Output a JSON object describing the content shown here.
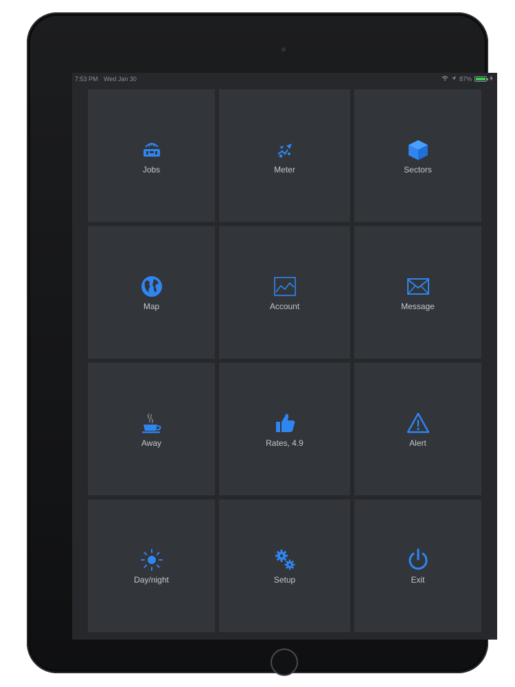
{
  "status_bar": {
    "time": "7:53 PM",
    "date": "Wed Jan 30",
    "battery_percent": "87%",
    "battery_level": 0.87
  },
  "menu": {
    "accent_color": "#2f86f0",
    "tiles": [
      {
        "label": "Jobs",
        "icon": "jobs-icon"
      },
      {
        "label": "Meter",
        "icon": "meter-icon"
      },
      {
        "label": "Sectors",
        "icon": "cube-icon"
      },
      {
        "label": "Map",
        "icon": "globe-icon"
      },
      {
        "label": "Account",
        "icon": "chart-icon"
      },
      {
        "label": "Message",
        "icon": "envelope-icon"
      },
      {
        "label": "Away",
        "icon": "coffee-cup-icon"
      },
      {
        "label": "Rates, 4.9",
        "icon": "thumbs-up-icon"
      },
      {
        "label": "Alert",
        "icon": "warning-icon"
      },
      {
        "label": "Day/night",
        "icon": "sun-icon"
      },
      {
        "label": "Setup",
        "icon": "gears-icon"
      },
      {
        "label": "Exit",
        "icon": "power-icon"
      }
    ]
  }
}
